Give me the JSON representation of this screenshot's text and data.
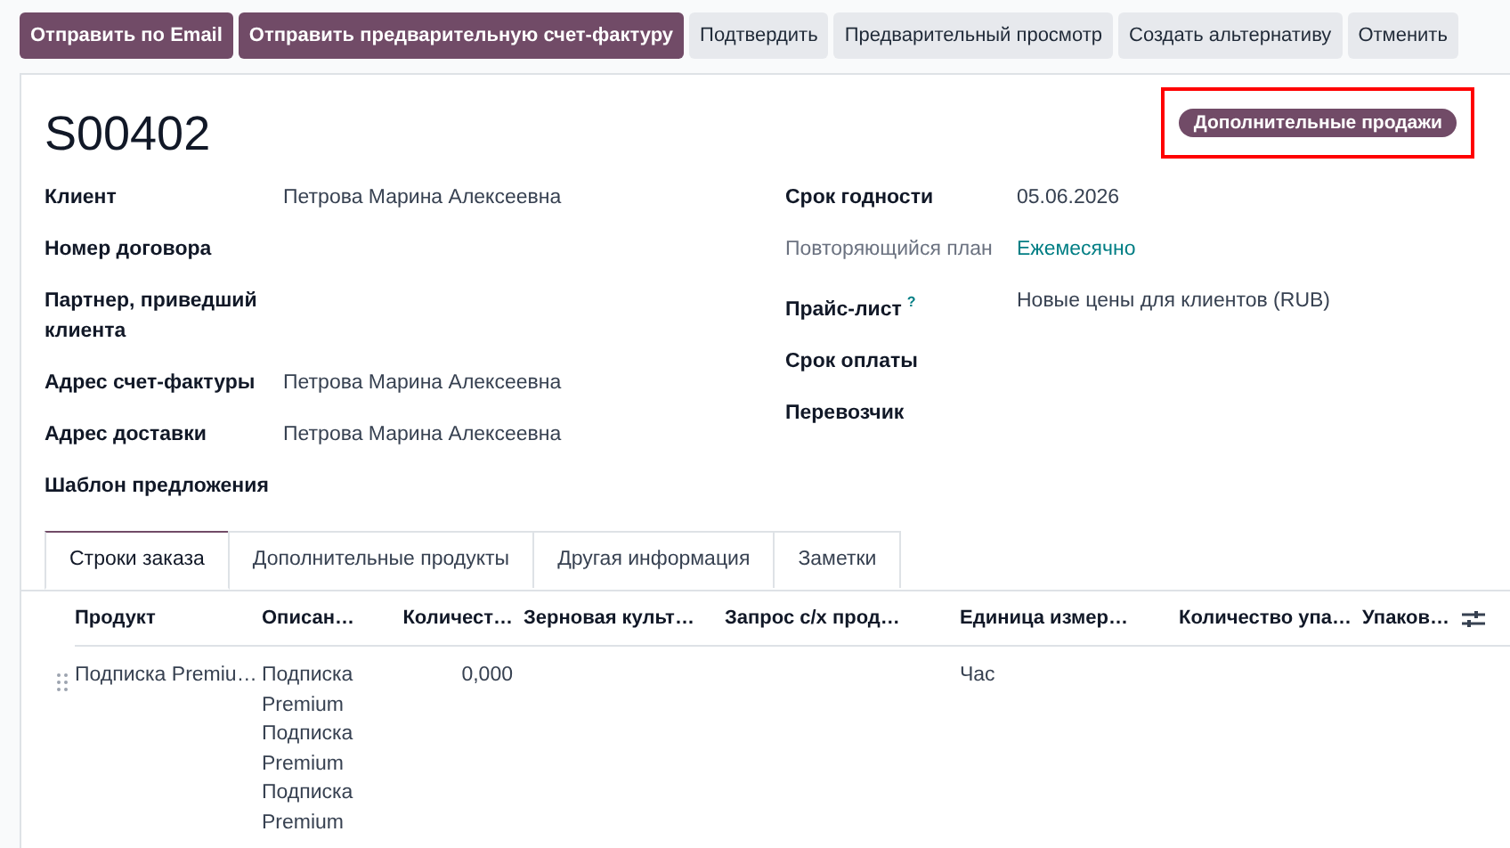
{
  "buttons": [
    {
      "label": "Отправить по Email",
      "kind": "primary"
    },
    {
      "label": "Отправить предварительную счет-фактуру",
      "kind": "primary"
    },
    {
      "label": "Подтвердить",
      "kind": "secondary"
    },
    {
      "label": "Предварительный просмотр",
      "kind": "secondary"
    },
    {
      "label": "Создать альтернативу",
      "kind": "secondary"
    },
    {
      "label": "Отменить",
      "kind": "secondary"
    }
  ],
  "record": {
    "title": "S00402",
    "tag": {
      "label": "Дополнительные продажи",
      "highlighted": true
    }
  },
  "fields_left": [
    {
      "label": "Клиент",
      "value": "Петрова Марина Алексеевна"
    },
    {
      "label": "Номер договора"
    },
    {
      "label": "Партнер, приведший клиента"
    },
    {
      "label": "Адрес счет-фактуры",
      "value": "Петрова Марина Алексеевна"
    },
    {
      "label": "Адрес доставки",
      "value": "Петрова Марина Алексеевна"
    },
    {
      "label": "Шаблон предложения"
    }
  ],
  "fields_right": [
    {
      "label": "Срок годности",
      "value": "05.06.2026"
    },
    {
      "label": "Повторяющийся план",
      "value": "Ежемесячно",
      "muted": true,
      "link": true
    },
    {
      "label": "Прайс-лист",
      "help": "?",
      "value": "Новые цены для клиентов (RUB)"
    },
    {
      "label": "Срок оплаты"
    },
    {
      "label": "Перевозчик"
    }
  ],
  "tabs": [
    {
      "label": "Строки заказа",
      "selected": true
    },
    {
      "label": "Дополнительные продукты",
      "selected": false
    },
    {
      "label": "Другая информация",
      "selected": false
    },
    {
      "label": "Заметки",
      "selected": false
    }
  ],
  "table": {
    "columns": [
      "Продукт",
      "Описан…",
      "Количест…",
      "Зерновая культ…",
      "Запрос с/х прод…",
      "Единица измер…",
      "Количество упа…",
      "Упаков…"
    ],
    "rows": [
      {
        "cells": [
          "Подписка Premiu…",
          "Подписка Premium Подписка Premium Подписка Premium",
          "0,000",
          "",
          "",
          "Час",
          "",
          ""
        ]
      }
    ]
  }
}
